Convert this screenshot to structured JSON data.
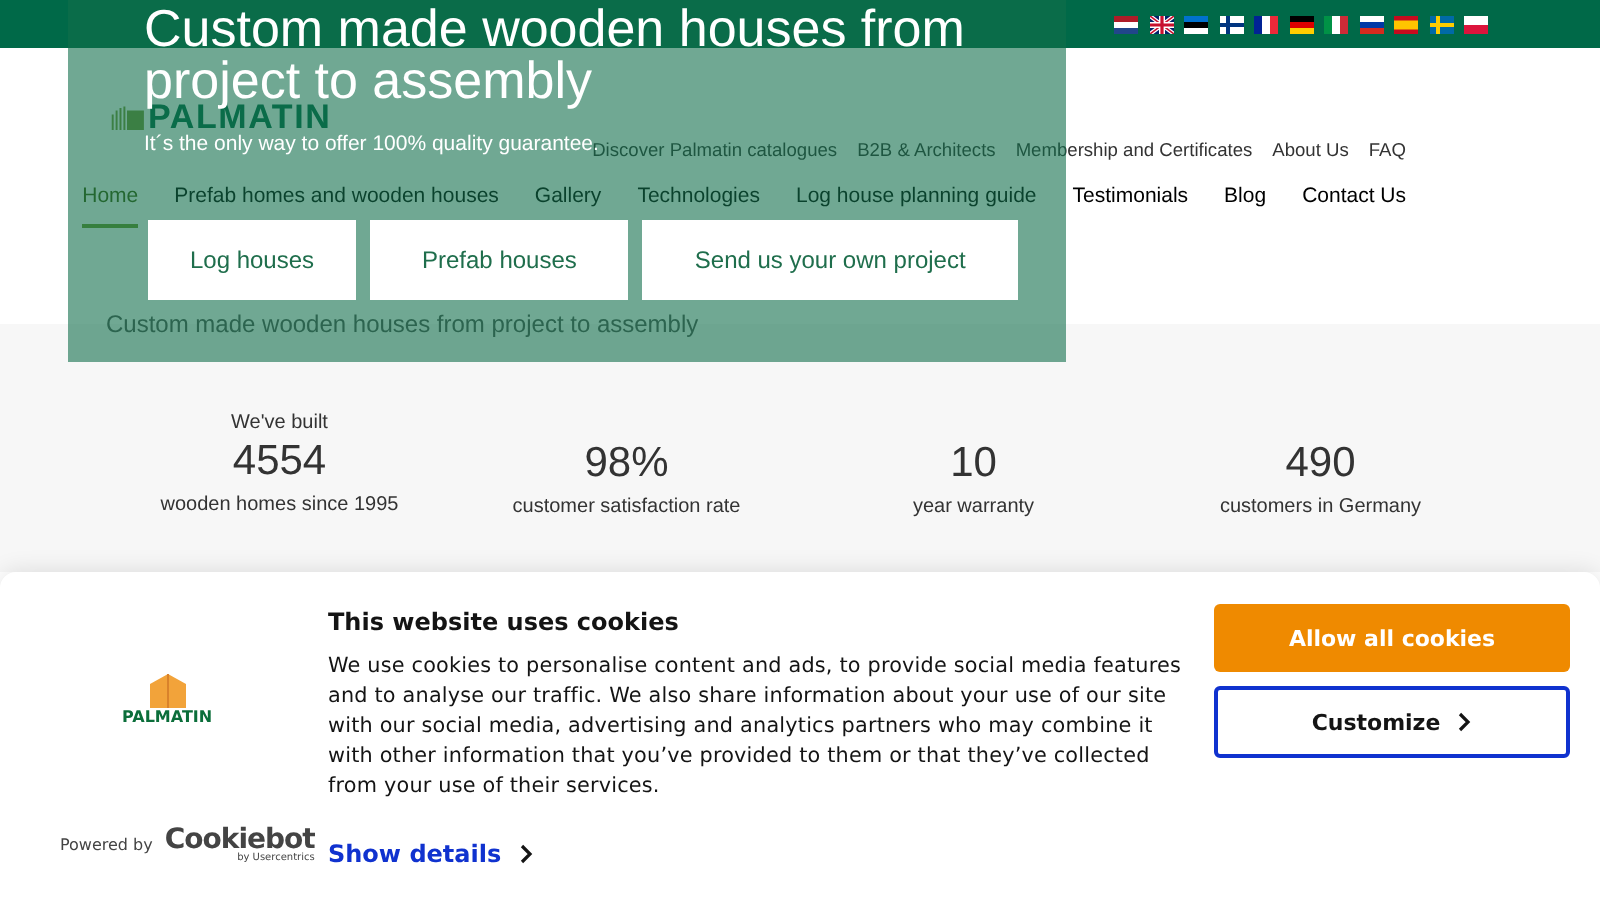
{
  "header": {
    "logo": "PALMATIN",
    "top_nav": [
      "Discover Palmatin catalogues",
      "B2B & Architects",
      "Membership and Certificates",
      "About Us",
      "FAQ"
    ],
    "main_nav": [
      {
        "label": "Home",
        "selected": true
      },
      {
        "label": "Prefab homes and wooden houses",
        "selected": false
      },
      {
        "label": "Gallery",
        "selected": false
      },
      {
        "label": "Technologies",
        "selected": false
      },
      {
        "label": "Log house planning guide",
        "selected": false
      },
      {
        "label": "Testimonials",
        "selected": false
      },
      {
        "label": "Blog",
        "selected": false
      },
      {
        "label": "Contact Us",
        "selected": false
      }
    ],
    "tagline": "Custom made wooden houses from project to assembly"
  },
  "hero": {
    "title": "Custom made wooden houses from project to assembly",
    "subtitle": "It´s the only way to offer 100% quality guarantee.",
    "buttons": [
      "Log houses",
      "Prefab houses",
      "Send us your own project"
    ]
  },
  "stats": [
    {
      "caption": "We've built",
      "value": "4554",
      "label": "wooden homes since 1995"
    },
    {
      "value": "98%",
      "label": "customer satisfaction rate"
    },
    {
      "value": "10",
      "label": "year warranty"
    },
    {
      "value": "490",
      "label": "customers in Germany"
    }
  ],
  "cookie_banner": {
    "logo": "PALMATIN",
    "powered_by": "Powered by",
    "provider": "Cookiebot",
    "provider_sub": "by Usercentrics",
    "title": "This website uses cookies",
    "body": "We use cookies to personalise content and ads, to provide social media features and to analyse our traffic. We also share information about your use of our site with our social media, advertising and analytics partners who may combine it with other information that you’ve provided to them or that they’ve collected from your use of their services.",
    "details_link": "Show details",
    "buttons": [
      {
        "label": "Allow all cookies",
        "kind": "primary"
      },
      {
        "label": "Customize",
        "kind": "secondary"
      }
    ]
  }
}
